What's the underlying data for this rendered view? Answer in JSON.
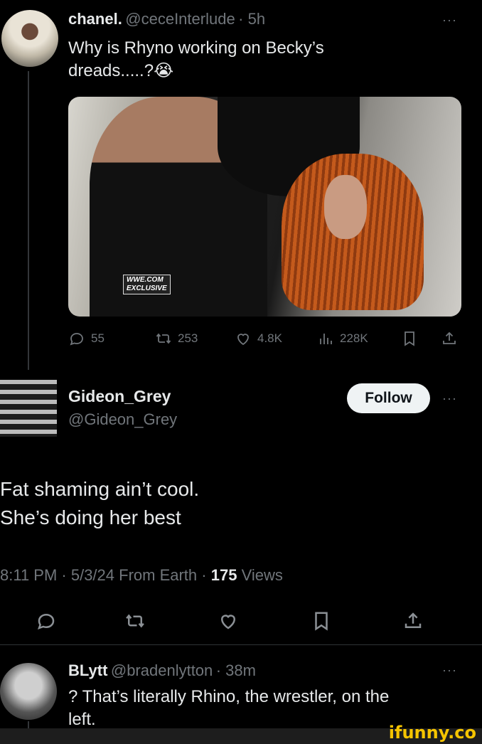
{
  "tweet1": {
    "name": "chanel.",
    "handle": "@ceceInterlude",
    "time": "· 5h",
    "text_line1": "Why is Rhyno working on Becky’s",
    "text_line2": "dreads.....?😭",
    "photo_badge_line1": "WWE.COM",
    "photo_badge_line2": "EXCLUSIVE",
    "replies": "55",
    "reposts": "253",
    "likes": "4.8K",
    "views": "228K",
    "more": "···"
  },
  "tweet2": {
    "name": "Gideon_Grey",
    "handle": "@Gideon_Grey",
    "follow_label": "Follow",
    "text_line1": "Fat shaming ain’t cool.",
    "text_line2": "She’s doing her best",
    "meta_time": "8:11 PM · 5/3/24 From Earth ·",
    "meta_views_count": "175",
    "meta_views_label": "Views",
    "more": "···"
  },
  "tweet3": {
    "name": "BLytt",
    "handle": "@bradenlytton",
    "time": "· 38m",
    "text_line1": "? That’s literally Rhino, the wrestler, on the",
    "text_line2": "left.",
    "more": "···"
  },
  "watermark": "ifunny.co",
  "icons": [
    "reply-icon",
    "repost-icon",
    "like-icon",
    "views-icon",
    "bookmark-icon",
    "share-icon"
  ],
  "colors": {
    "background": "#000000",
    "text": "#e7e9ea",
    "muted": "#71767b",
    "watermark": "#f5c400"
  }
}
